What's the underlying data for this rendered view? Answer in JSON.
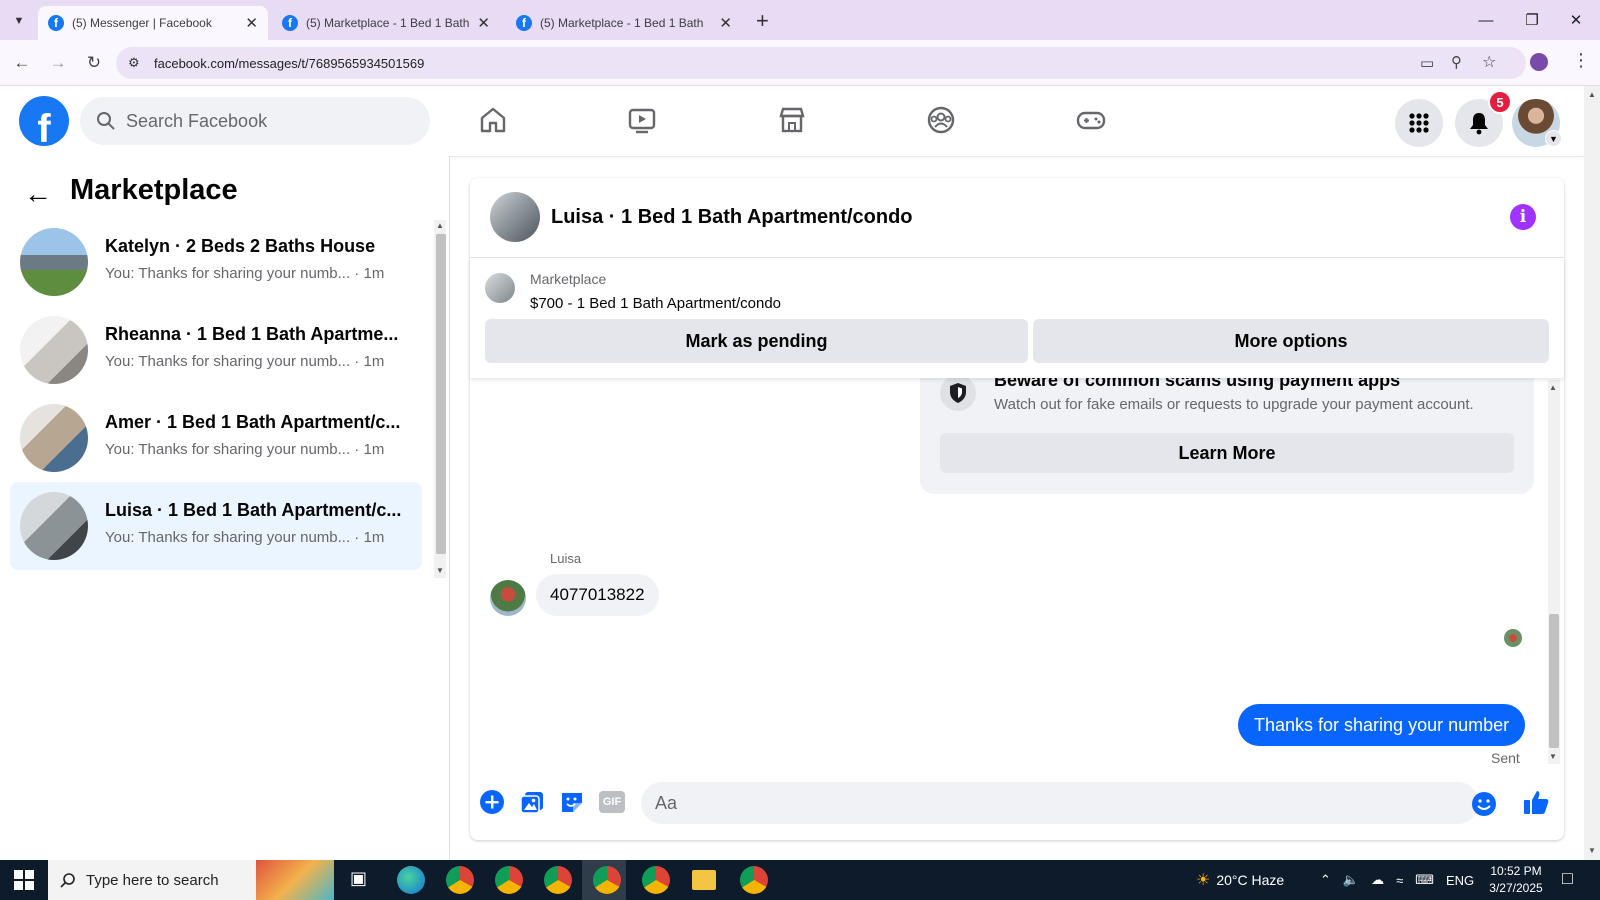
{
  "browser": {
    "tabs": [
      {
        "title": "(5) Messenger | Facebook",
        "active": true
      },
      {
        "title": "(5) Marketplace - 1 Bed 1 Bath",
        "active": false
      },
      {
        "title": "(5) Marketplace - 1 Bed 1 Bath",
        "active": false
      }
    ],
    "url": "facebook.com/messages/t/7689565934501569"
  },
  "fb": {
    "search_placeholder": "Search Facebook",
    "notification_count": "5",
    "brand_color": "#1877f2",
    "nav_icons": [
      "home-icon",
      "watch-icon",
      "marketplace-icon",
      "groups-icon",
      "gaming-icon"
    ]
  },
  "sidebar": {
    "title": "Marketplace",
    "conversations": [
      {
        "name": "Katelyn · 2 Beds 2 Baths House",
        "preview": "You: Thanks for sharing your numb... · 1m"
      },
      {
        "name": "Rheanna · 1 Bed 1 Bath Apartme...",
        "preview": "You: Thanks for sharing your numb... · 1m"
      },
      {
        "name": "Amer · 1 Bed 1 Bath Apartment/c...",
        "preview": "You: Thanks for sharing your numb... · 1m"
      },
      {
        "name": "Luisa · 1 Bed 1 Bath Apartment/c...",
        "preview": "You: Thanks for sharing your numb... · 1m",
        "active": true
      }
    ]
  },
  "chat": {
    "title": "Luisa · 1 Bed 1 Bath Apartment/condo",
    "listing": {
      "label": "Marketplace",
      "price_title": "$700 - 1 Bed 1 Bath Apartment/condo"
    },
    "actions": {
      "pending": "Mark as pending",
      "more": "More options"
    },
    "scam_notice": {
      "title": "Beware of common scams using payment apps",
      "desc": "Watch out for fake emails or requests to upgrade your payment account.",
      "button": "Learn More"
    },
    "messages": {
      "sender": "Luisa",
      "received": "4077013822",
      "sent": "Thanks for sharing your number",
      "status": "Sent"
    },
    "composer_placeholder": "Aa",
    "accent": "#0866ff"
  },
  "taskbar": {
    "search": "Type here to search",
    "weather": "20°C  Haze",
    "lang": "ENG",
    "time": "10:52 PM",
    "date": "3/27/2025"
  }
}
